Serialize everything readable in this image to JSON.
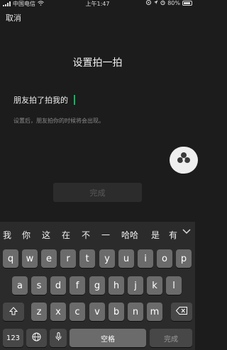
{
  "status_bar": {
    "carrier": "中国电信",
    "time": "上午1:47",
    "battery": "80%"
  },
  "nav": {
    "cancel": "取消"
  },
  "page": {
    "title": "设置拍一拍",
    "input_value": "朋友拍了拍我的",
    "hint": "设置后，朋友拍你的时候将会出现。",
    "done": "完成"
  },
  "keyboard": {
    "candidates": [
      "我",
      "你",
      "这",
      "在",
      "不",
      "一",
      "哈哈",
      "是",
      "有"
    ],
    "row1": [
      "q",
      "w",
      "e",
      "r",
      "t",
      "y",
      "u",
      "i",
      "o",
      "p"
    ],
    "row2": [
      "a",
      "s",
      "d",
      "f",
      "g",
      "h",
      "j",
      "k",
      "l"
    ],
    "row3": [
      "z",
      "x",
      "c",
      "v",
      "b",
      "n",
      "m"
    ],
    "numbers_key": "123",
    "space_key": "空格",
    "done_key": "完成"
  }
}
